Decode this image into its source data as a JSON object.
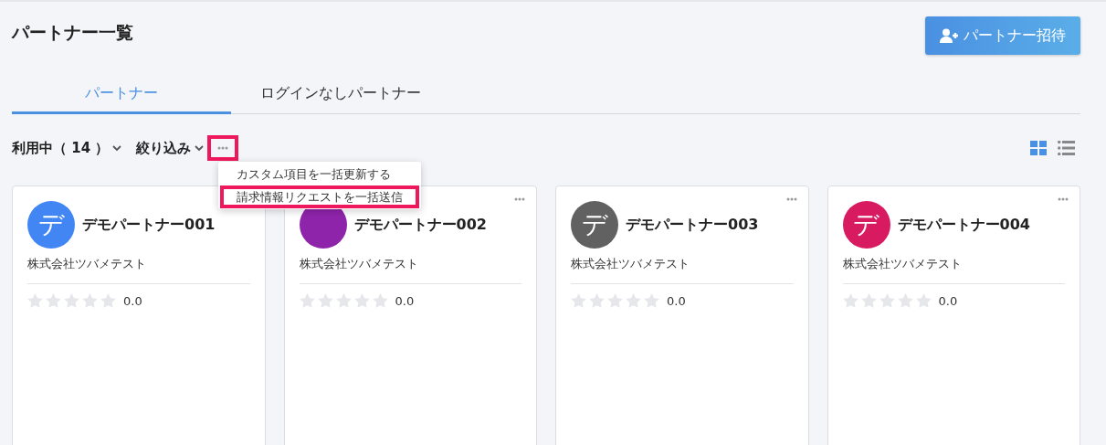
{
  "page": {
    "title": "パートナー一覧"
  },
  "invite_button": {
    "label": "パートナー招待"
  },
  "tabs": [
    {
      "label": "パートナー",
      "selected": true
    },
    {
      "label": "ログインなしパートナー",
      "selected": false
    }
  ],
  "filters": {
    "status": "利用中（ 14 ）",
    "filter": "絞り込み",
    "more_highlighted": true
  },
  "view_toggle": [
    {
      "kind": "grid",
      "selected": true
    },
    {
      "kind": "list",
      "selected": false
    }
  ],
  "menu": [
    {
      "label": "カスタム項目を一括更新する",
      "highlighted": false
    },
    {
      "label": "請求情報リクエストを一括送信",
      "highlighted": true
    }
  ],
  "cards": [
    {
      "initial": "デ",
      "color": "#4286f4",
      "name": "デモパートナー001",
      "company": "株式会社ツバメテスト",
      "stars": 0,
      "rating": "0.0",
      "menu_icon": false
    },
    {
      "color": "#8e24aa",
      "name": "デモパートナー002",
      "company": "株式会社ツバメテスト",
      "stars": 0,
      "rating": "0.0",
      "menu_icon": true
    },
    {
      "initial": "デ",
      "color": "#616161",
      "name": "デモパートナー003",
      "company": "株式会社ツバメテスト",
      "stars": 0,
      "rating": "0.0",
      "menu_icon": true
    },
    {
      "initial": "デ",
      "color": "#d81b60",
      "name": "デモパートナー004",
      "company": "株式会社ツバメテスト",
      "stars": 0,
      "rating": "0.0",
      "menu_icon": true
    }
  ]
}
